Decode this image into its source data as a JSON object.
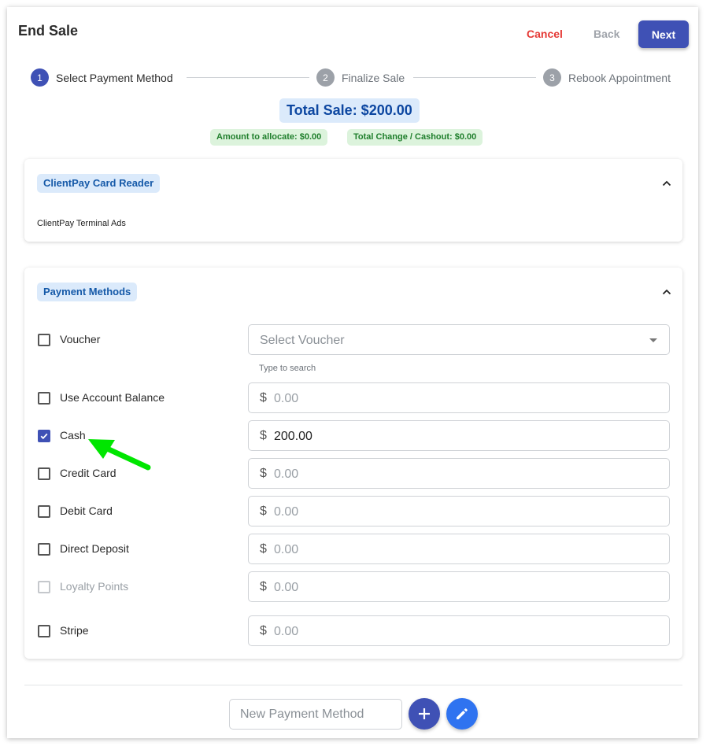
{
  "header": {
    "title": "End Sale",
    "cancel_label": "Cancel",
    "back_label": "Back",
    "next_label": "Next"
  },
  "stepper": {
    "steps": [
      {
        "number": "1",
        "label": "Select Payment Method",
        "state": "active"
      },
      {
        "number": "2",
        "label": "Finalize Sale",
        "state": "inactive"
      },
      {
        "number": "3",
        "label": "Rebook Appointment",
        "state": "inactive"
      }
    ]
  },
  "summary": {
    "total_sale": "Total Sale: $200.00",
    "amount_to_allocate": "Amount to allocate: $0.00",
    "total_change": "Total Change / Cashout: $0.00"
  },
  "card_reader": {
    "title": "ClientPay Card Reader",
    "text": "ClientPay Terminal Ads",
    "icon": "chevron-up-icon"
  },
  "payment_methods": {
    "title": "Payment Methods",
    "icon": "chevron-up-icon",
    "voucher": {
      "label": "Voucher",
      "placeholder": "Select Voucher",
      "hint": "Type to search",
      "checked": false
    },
    "currency_symbol": "$",
    "rows": [
      {
        "label": "Use Account Balance",
        "amount": "0.00",
        "checked": false,
        "disabled": false
      },
      {
        "label": "Cash",
        "amount": "200.00",
        "checked": true,
        "disabled": false
      },
      {
        "label": "Credit Card",
        "amount": "0.00",
        "checked": false,
        "disabled": false
      },
      {
        "label": "Debit Card",
        "amount": "0.00",
        "checked": false,
        "disabled": false
      },
      {
        "label": "Direct Deposit",
        "amount": "0.00",
        "checked": false,
        "disabled": false
      },
      {
        "label": "Loyalty Points",
        "amount": "0.00",
        "checked": false,
        "disabled": true
      },
      {
        "label": "Stripe",
        "amount": "0.00",
        "checked": false,
        "disabled": false
      }
    ]
  },
  "footer": {
    "new_method_placeholder": "New Payment Method",
    "add_icon": "plus-icon",
    "edit_icon": "pencil-icon"
  },
  "colors": {
    "primary": "#3f51b5",
    "danger": "#e53935",
    "annotation_arrow": "#00e600",
    "chip_blue_bg": "#dbeafb",
    "chip_green_bg": "#dcf3dc"
  }
}
